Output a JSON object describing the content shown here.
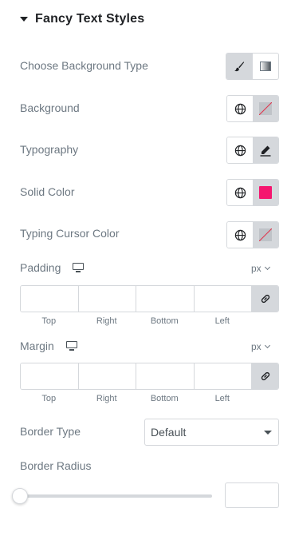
{
  "section": {
    "title": "Fancy Text Styles"
  },
  "rows": {
    "background_type": {
      "label": "Choose Background Type",
      "options": [
        "brush-icon",
        "gradient-icon"
      ],
      "selected": 0
    },
    "background": {
      "label": "Background"
    },
    "typography": {
      "label": "Typography"
    },
    "solid_color": {
      "label": "Solid Color",
      "color": "#f5166f"
    },
    "cursor_color": {
      "label": "Typing Cursor Color"
    }
  },
  "padding": {
    "label": "Padding",
    "unit": "px",
    "fields": {
      "top": "",
      "right": "",
      "bottom": "",
      "left": ""
    },
    "captions": {
      "top": "Top",
      "right": "Right",
      "bottom": "Bottom",
      "left": "Left"
    }
  },
  "margin": {
    "label": "Margin",
    "unit": "px",
    "fields": {
      "top": "",
      "right": "",
      "bottom": "",
      "left": ""
    },
    "captions": {
      "top": "Top",
      "right": "Right",
      "bottom": "Bottom",
      "left": "Left"
    }
  },
  "border_type": {
    "label": "Border Type",
    "value": "Default"
  },
  "border_radius": {
    "label": "Border Radius",
    "value": "",
    "slider_level": 0
  },
  "colors": {
    "active_segment": "#d5d8dc",
    "border": "#d5d8dc",
    "heading": "#1f2124",
    "label": "#6d7882"
  }
}
